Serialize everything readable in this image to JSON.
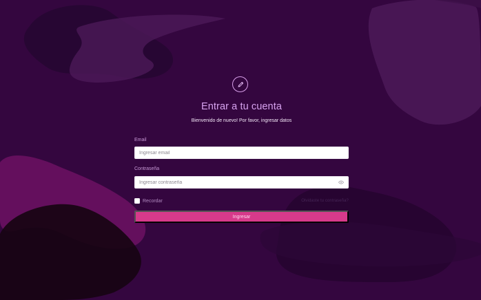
{
  "header": {
    "logo_icon": "pencil-icon",
    "title": "Entrar a tu cuenta",
    "subtitle": "Bienvenido de nuevo! Por favor, ingresar datos"
  },
  "form": {
    "email_label": "Email",
    "email_placeholder": "Ingresar email",
    "password_label": "Contraseña",
    "password_placeholder": "Ingresar contraseña",
    "remember_label": "Recordar",
    "forgot_label": "Olvidaste tu contraseña?",
    "submit_label": "Ingresar",
    "password_icon": "eye-icon"
  },
  "colors": {
    "background": "#34063F",
    "accent": "#D73A8B",
    "title": "#D7A2EF"
  }
}
